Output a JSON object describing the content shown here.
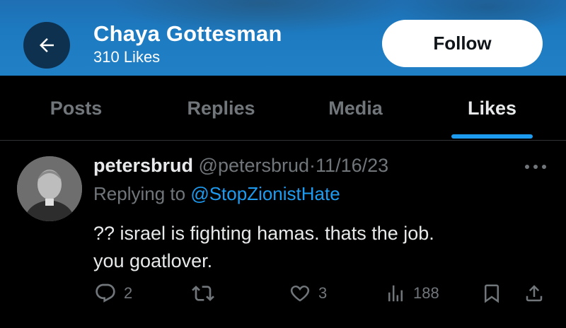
{
  "header": {
    "name": "Chaya Gottesman",
    "subtitle": "310 Likes",
    "follow_label": "Follow",
    "back_icon": "arrow-left-icon",
    "colors": {
      "header_bg": "#1d7ac0",
      "back_bg": "#0f3150",
      "follow_bg": "#ffffff"
    }
  },
  "tabs": [
    {
      "label": "Posts",
      "active": false
    },
    {
      "label": "Replies",
      "active": false
    },
    {
      "label": "Media",
      "active": false
    },
    {
      "label": "Likes",
      "active": true
    }
  ],
  "post": {
    "author_name": "petersbrud",
    "author_handle": "@petersbrud",
    "separator": "·",
    "date": "11/16/23",
    "replying_prefix": "Replying to",
    "replying_to": "@StopZionistHate",
    "text_line1": "?? israel is fighting hamas. thats the job.",
    "text_line2": "you goatlover.",
    "actions": {
      "replies": "2",
      "reposts": "",
      "likes": "3",
      "views": "188"
    },
    "colors": {
      "accent": "#1d9bf0",
      "muted": "#71767b",
      "text": "#e7e9ea"
    }
  }
}
